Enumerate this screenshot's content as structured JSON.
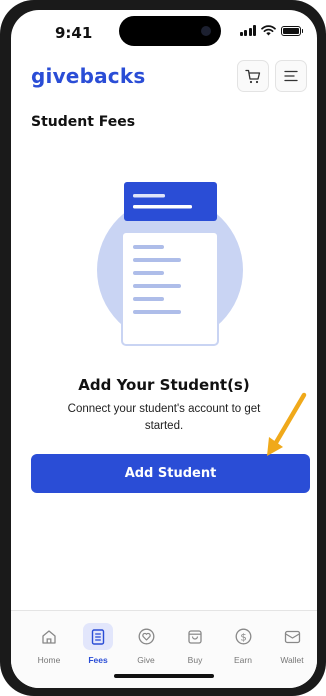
{
  "status_bar": {
    "time": "9:41"
  },
  "header": {
    "logo": "givebacks",
    "cart_icon": "cart-icon",
    "menu_icon": "menu-icon"
  },
  "page": {
    "title": "Student Fees"
  },
  "empty_state": {
    "title": "Add Your Student(s)",
    "description": "Connect your student's account to get started.",
    "button_label": "Add Student"
  },
  "tabs": [
    {
      "label": "Home",
      "icon": "home-icon",
      "active": false
    },
    {
      "label": "Fees",
      "icon": "fees-icon",
      "active": true
    },
    {
      "label": "Give",
      "icon": "give-icon",
      "active": false
    },
    {
      "label": "Buy",
      "icon": "buy-icon",
      "active": false
    },
    {
      "label": "Earn",
      "icon": "earn-icon",
      "active": false
    },
    {
      "label": "Wallet",
      "icon": "wallet-icon",
      "active": false
    }
  ],
  "colors": {
    "accent": "#2a4dd6",
    "illustration_circle": "#c9d4f3",
    "arrow": "#f0a91a"
  }
}
